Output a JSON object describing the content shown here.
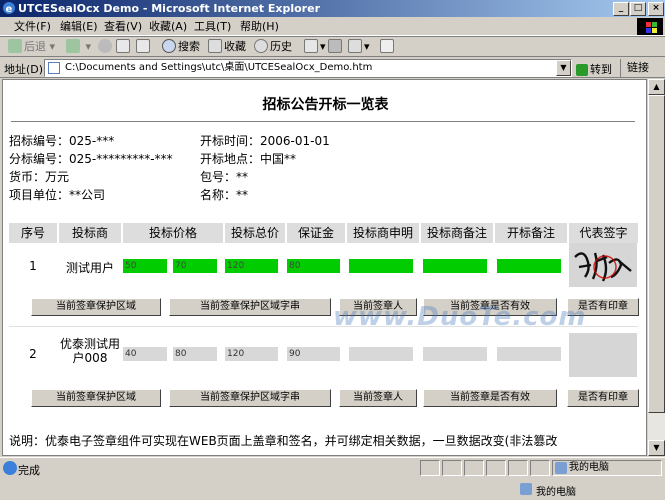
{
  "window": {
    "title": "UTCESealOcx Demo - Microsoft Internet Explorer"
  },
  "menu": [
    "文件(F)",
    "编辑(E)",
    "查看(V)",
    "收藏(A)",
    "工具(T)",
    "帮助(H)"
  ],
  "toolbar": {
    "back": "后退",
    "search": "搜索",
    "favorites": "收藏",
    "history": "历史"
  },
  "address": {
    "label": "地址(D)",
    "value": "C:\\Documents and Settings\\utc\\桌面\\UTCESealOcx_Demo.htm",
    "go": "转到",
    "links": "链接"
  },
  "page": {
    "title": "招标公告开标一览表",
    "info": [
      {
        "label": "招标编号：",
        "value": "025-***"
      },
      {
        "label": "开标时间：",
        "value": "2006-01-01"
      },
      {
        "label": "分标编号：",
        "value": "025-*********-***"
      },
      {
        "label": "开标地点：",
        "value": "中国**"
      },
      {
        "label": "货币：",
        "value": "万元"
      },
      {
        "label": "包号：",
        "value": "**"
      },
      {
        "label": "项目单位：",
        "value": "**公司"
      },
      {
        "label": "名称：",
        "value": "**"
      }
    ],
    "headers": [
      "序号",
      "投标商",
      "投标价格",
      "投标总价",
      "保证金",
      "投标商申明",
      "投标商备注",
      "开标备注",
      "代表签字"
    ],
    "rows": [
      {
        "no": "1",
        "bidder": "测试用户",
        "values": [
          "50",
          "70",
          "120",
          "80",
          "",
          "",
          ""
        ],
        "signed": true
      },
      {
        "no": "2",
        "bidder": "优泰测试用户008",
        "values": [
          "40",
          "80",
          "120",
          "90",
          "",
          "",
          ""
        ],
        "signed": false
      }
    ],
    "buttons": [
      "当前签章保护区域",
      "当前签章保护区域字串",
      "当前签章人",
      "当前签章是否有效",
      "是否有印章"
    ],
    "note": "说明：优泰电子签章组件可实现在WEB页面上盖章和签名，并可绑定相关数据，一旦数据改变(非法篡改",
    "watermark": "www.DuoTe.com"
  },
  "status": {
    "text": "完成",
    "zone": "我的电脑",
    "zone2": "我的电脑"
  }
}
